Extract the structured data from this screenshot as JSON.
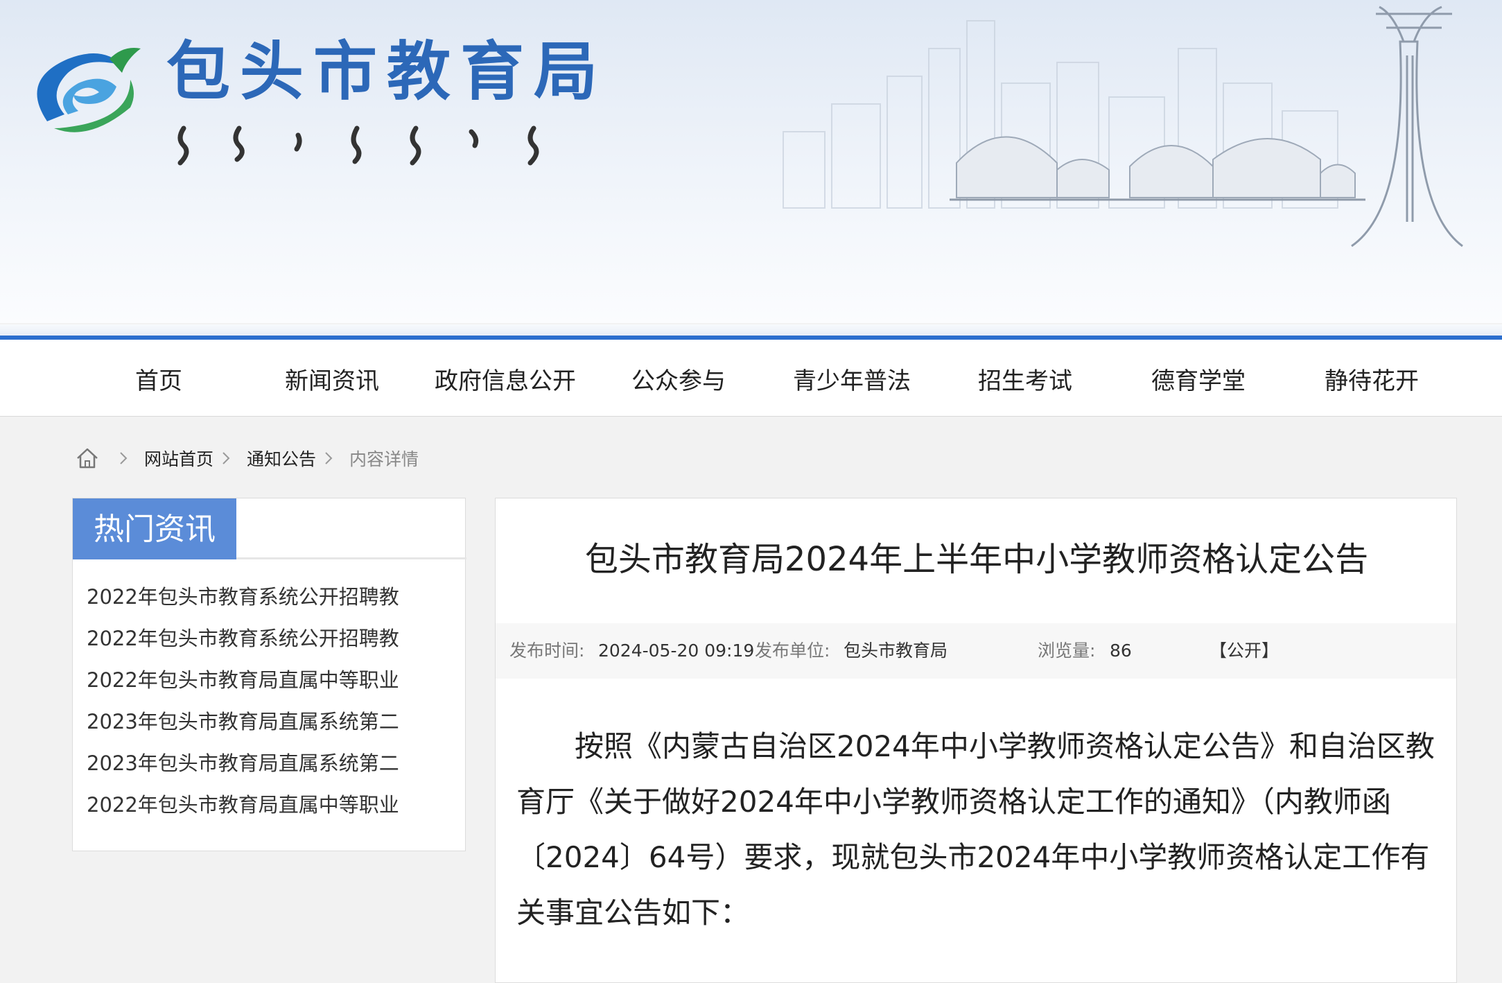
{
  "header": {
    "site_title": "包头市教育局",
    "logo_icon": "education-bureau-logo-icon",
    "colors": {
      "title_blue": "#2c68b8",
      "nav_line": "#2c6fce",
      "sidebar_tab": "#5b8cd8"
    }
  },
  "nav": {
    "items": [
      {
        "label": "首页"
      },
      {
        "label": "新闻资讯"
      },
      {
        "label": "政府信息公开"
      },
      {
        "label": "公众参与"
      },
      {
        "label": "青少年普法"
      },
      {
        "label": "招生考试"
      },
      {
        "label": "德育学堂"
      },
      {
        "label": "静待花开"
      }
    ]
  },
  "breadcrumb": {
    "home_icon": "home-icon",
    "items": [
      {
        "label": "网站首页"
      },
      {
        "label": "通知公告"
      },
      {
        "label": "内容详情"
      }
    ]
  },
  "sidebar": {
    "title": "热门资讯",
    "items": [
      {
        "label": "2022年包头市教育系统公开招聘教"
      },
      {
        "label": "2022年包头市教育系统公开招聘教"
      },
      {
        "label": "2022年包头市教育局直属中等职业"
      },
      {
        "label": "2023年包头市教育局直属系统第二"
      },
      {
        "label": "2023年包头市教育局直属系统第二"
      },
      {
        "label": "2022年包头市教育局直属中等职业"
      }
    ]
  },
  "article": {
    "title": "包头市教育局2024年上半年中小学教师资格认定公告",
    "meta": {
      "publish_time_label": "发布时间:",
      "publish_time": "2024-05-20 09:19",
      "publisher_label": "发布单位:",
      "publisher": "包头市教育局",
      "views_label": "浏览量:",
      "views": "86",
      "visibility": "【公开】"
    },
    "body": "按照《内蒙古自治区2024年中小学教师资格认定公告》和自治区教育厅《关于做好2024年中小学教师资格认定工作的通知》（内教师函〔2024〕64号）要求，现就包头市2024年中小学教师资格认定工作有关事宜公告如下："
  }
}
